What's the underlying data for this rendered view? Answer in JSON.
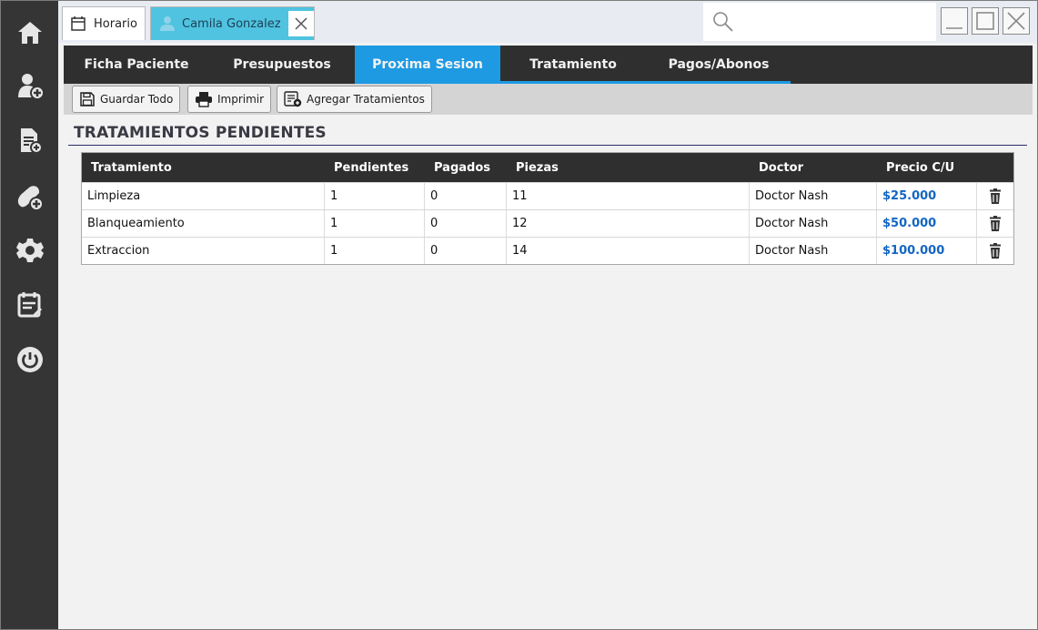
{
  "tabs": {
    "horario": {
      "label": "Horario",
      "icon": "calendar-icon"
    },
    "patient": {
      "label": "Camila Gonzalez",
      "icon": "person-icon"
    }
  },
  "nav_tabs": [
    {
      "label": "Ficha Paciente",
      "active": false
    },
    {
      "label": "Presupuestos",
      "active": false
    },
    {
      "label": "Proxima Sesion",
      "active": true
    },
    {
      "label": "Tratamiento",
      "active": false
    },
    {
      "label": "Pagos/Abonos",
      "active": false
    }
  ],
  "toolbar": {
    "save_label": "Guardar Todo",
    "print_label": "Imprimir",
    "add_label": "Agregar Tratamientos"
  },
  "section": {
    "title": "TRATAMIENTOS PENDIENTES"
  },
  "table": {
    "headers": [
      "Tratamiento",
      "Pendientes",
      "Pagados",
      "Piezas",
      "Doctor",
      "Precio C/U"
    ],
    "rows": [
      {
        "tratamiento": "Limpieza",
        "pendientes": "1",
        "pagados": "0",
        "piezas": "11",
        "doctor": "Doctor Nash",
        "precio": "$25.000"
      },
      {
        "tratamiento": "Blanqueamiento",
        "pendientes": "1",
        "pagados": "0",
        "piezas": "12",
        "doctor": "Doctor Nash",
        "precio": "$50.000"
      },
      {
        "tratamiento": "Extraccion",
        "pendientes": "1",
        "pagados": "0",
        "piezas": "14",
        "doctor": "Doctor Nash",
        "precio": "$100.000"
      }
    ]
  },
  "colors": {
    "accent": "#1e9ae3",
    "patient_tab": "#4fc3e0",
    "price": "#1366c2",
    "rail": "#353535"
  }
}
